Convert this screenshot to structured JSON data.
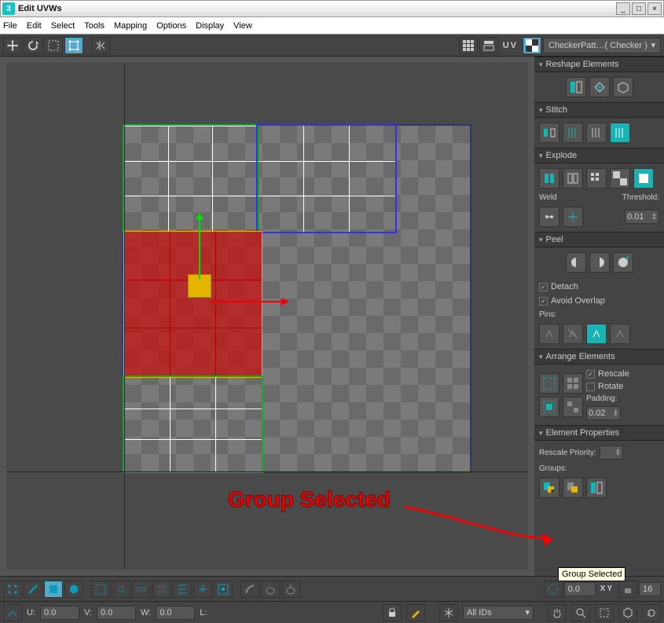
{
  "window": {
    "title": "Edit UVWs"
  },
  "menu": [
    "File",
    "Edit",
    "Select",
    "Tools",
    "Mapping",
    "Options",
    "Display",
    "View"
  ],
  "material_dropdown": "CheckerPatt…( Checker )",
  "uv_label": "UV",
  "rollouts": {
    "reshape": "Reshape Elements",
    "stitch": "Stitch",
    "explode": "Explode",
    "weld_label": "Weld",
    "threshold_label": "Threshold:",
    "threshold_val": "0.01",
    "peel": "Peel",
    "detach": "Detach",
    "avoid_overlap": "Avoid Overlap",
    "pins": "Pins:",
    "arrange": "Arrange Elements",
    "rescale": "Rescale",
    "rotate": "Rotate",
    "padding": "Padding:",
    "padding_val": "0.02",
    "elemprops": "Element Properties",
    "rescale_priority": "Rescale Priority:",
    "groups": "Groups:"
  },
  "tooltip": "Group Selected",
  "callout": "Group Selected",
  "status": {
    "u_lbl": "U:",
    "u_val": "0.0",
    "v_lbl": "V:",
    "v_val": "0.0",
    "w_lbl": "W:",
    "w_val": "0.0",
    "l_lbl": "L:",
    "ids": "All IDs",
    "xy": "XY",
    "softsel": "0.0",
    "count": "16"
  }
}
